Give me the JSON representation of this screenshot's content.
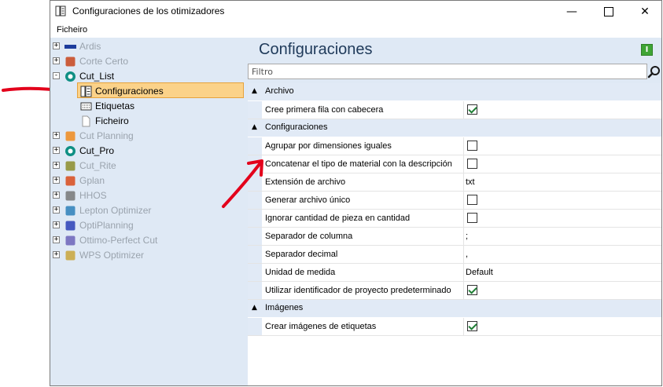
{
  "window": {
    "title": "Configuraciones de los otimizadores"
  },
  "menu": {
    "items": [
      "Ficheiro"
    ]
  },
  "tree": {
    "items": [
      {
        "label": "Ardis",
        "icon": "ardis-logo-icon",
        "expander": "+",
        "enabled": false
      },
      {
        "label": "Corte Certo",
        "icon": "corte-certo-icon",
        "expander": "+",
        "enabled": false
      },
      {
        "label": "Cut_List",
        "icon": "cutlist-globe-icon",
        "expander": "−",
        "enabled": true
      },
      {
        "label": "Configuraciones",
        "icon": "settings-list-icon",
        "expander": "",
        "enabled": true,
        "selected": true
      },
      {
        "label": "Etiquetas",
        "icon": "labels-icon",
        "expander": "",
        "enabled": true
      },
      {
        "label": "Ficheiro",
        "icon": "file-icon",
        "expander": "",
        "enabled": true
      },
      {
        "label": "Cut Planning",
        "icon": "cut-planning-icon",
        "expander": "+",
        "enabled": false
      },
      {
        "label": "Cut_Pro",
        "icon": "cutpro-globe-icon",
        "expander": "+",
        "enabled": true
      },
      {
        "label": "Cut_Rite",
        "icon": "cutrite-icon",
        "expander": "+",
        "enabled": false
      },
      {
        "label": "Gplan",
        "icon": "gplan-icon",
        "expander": "+",
        "enabled": false
      },
      {
        "label": "HHOS",
        "icon": "hhos-icon",
        "expander": "+",
        "enabled": false
      },
      {
        "label": "Lepton Optimizer",
        "icon": "lepton-icon",
        "expander": "+",
        "enabled": false
      },
      {
        "label": "OptiPlanning",
        "icon": "optiplanning-icon",
        "expander": "+",
        "enabled": false
      },
      {
        "label": "Ottimo-Perfect Cut",
        "icon": "ottimo-icon",
        "expander": "+",
        "enabled": false
      },
      {
        "label": "WPS Optimizer",
        "icon": "wps-icon",
        "expander": "+",
        "enabled": false
      }
    ]
  },
  "panel": {
    "title": "Configuraciones",
    "filter_placeholder": "Filtro",
    "info_label": "I"
  },
  "grid": {
    "categories": [
      {
        "label": "Archivo",
        "rows": [
          {
            "name": "Cree primera fila con cabecera",
            "type": "check",
            "checked": true
          }
        ]
      },
      {
        "label": "Configuraciones",
        "rows": [
          {
            "name": "Agrupar por dimensiones iguales",
            "type": "check",
            "checked": false
          },
          {
            "name": "Concatenar el tipo de material con la descripción",
            "type": "check",
            "checked": false
          },
          {
            "name": "Extensión de archivo",
            "type": "text",
            "value": "txt"
          },
          {
            "name": "Generar archivo único",
            "type": "check",
            "checked": false
          },
          {
            "name": "Ignorar cantidad de pieza en cantidad",
            "type": "check",
            "checked": false
          },
          {
            "name": "Separador de columna",
            "type": "text",
            "value": ";"
          },
          {
            "name": "Separador decimal",
            "type": "text",
            "value": ","
          },
          {
            "name": "Unidad de medida",
            "type": "text",
            "value": "Default"
          },
          {
            "name": "Utilizar identificador de proyecto predeterminado",
            "type": "check",
            "checked": true
          }
        ]
      },
      {
        "label": "Imágenes",
        "rows": [
          {
            "name": "Crear imágenes de etiquetas",
            "type": "check",
            "checked": true
          }
        ]
      }
    ]
  },
  "colors": {
    "accent_selected": "#fbd289",
    "panel_bg": "#dfe9f5",
    "annotation_arrow": "#e3001b"
  }
}
